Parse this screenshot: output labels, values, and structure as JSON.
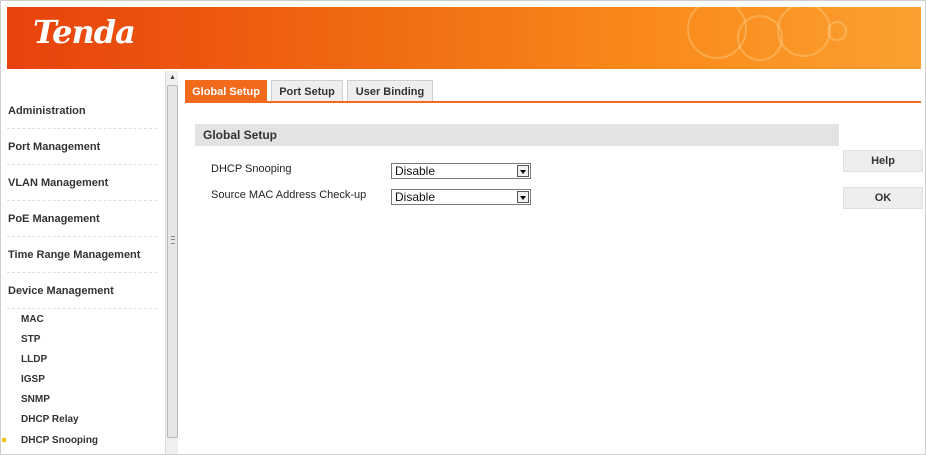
{
  "header": {
    "logo_text": "Tenda",
    "brand_color": "#f26a1b"
  },
  "sidebar": {
    "items": [
      {
        "label": "Administration"
      },
      {
        "label": "Port Management"
      },
      {
        "label": "VLAN Management"
      },
      {
        "label": "PoE Management"
      },
      {
        "label": "Time Range Management"
      },
      {
        "label": "Device Management"
      }
    ],
    "sub_items": [
      {
        "label": "MAC"
      },
      {
        "label": "STP"
      },
      {
        "label": "LLDP"
      },
      {
        "label": "IGSP"
      },
      {
        "label": "SNMP"
      },
      {
        "label": "DHCP Relay"
      },
      {
        "label": "DHCP Snooping",
        "active": true
      }
    ]
  },
  "tabs": [
    {
      "label": "Global Setup",
      "active": true
    },
    {
      "label": "Port Setup",
      "active": false
    },
    {
      "label": "User Binding",
      "active": false
    }
  ],
  "section": {
    "title": "Global Setup",
    "fields": [
      {
        "label": "DHCP Snooping",
        "value": "Disable"
      },
      {
        "label": "Source MAC Address Check-up",
        "value": "Disable"
      }
    ]
  },
  "buttons": {
    "help": "Help",
    "ok": "OK"
  }
}
